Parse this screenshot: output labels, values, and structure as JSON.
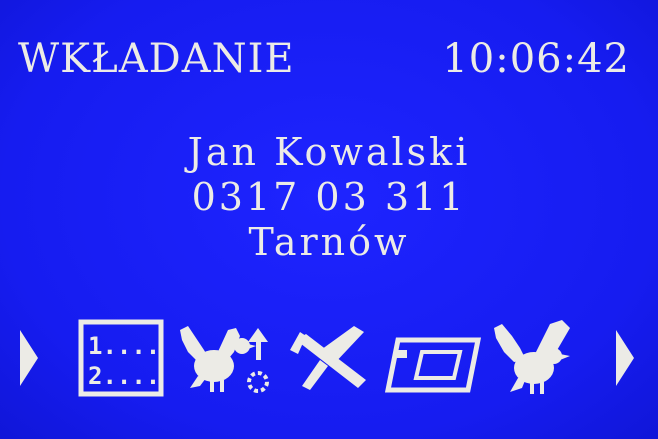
{
  "status": {
    "mode": "WKŁADANIE",
    "time": "10:06:42"
  },
  "card": {
    "name": "Jan Kowalski",
    "number": "0317 03 311",
    "city": "Tarnów"
  },
  "toolbar": {
    "list_icon": {
      "line1": "1....",
      "line2": "2...."
    },
    "icons": [
      "arrow-left-icon",
      "numbered-list-icon",
      "bird-send-icon",
      "plane-icon",
      "card-icon",
      "bird-icon",
      "arrow-right-icon"
    ]
  },
  "colors": {
    "background": "#1a1ff0",
    "foreground": "#ecebe6"
  }
}
